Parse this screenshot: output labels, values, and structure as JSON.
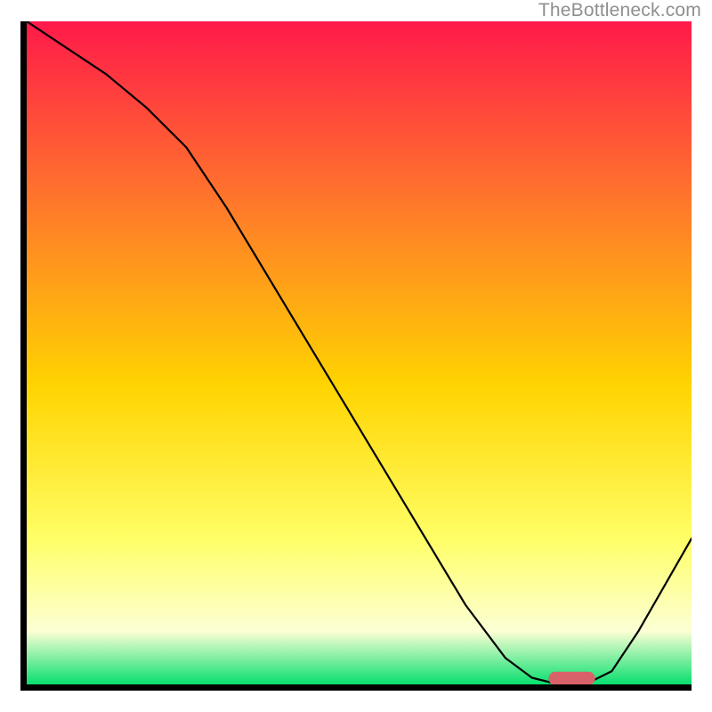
{
  "watermark": "TheBottleneck.com",
  "chart_data": {
    "type": "line",
    "title": "",
    "xlabel": "",
    "ylabel": "",
    "xlim": [
      0,
      100
    ],
    "ylim": [
      0,
      100
    ],
    "grid": false,
    "gradient_colors": {
      "top": "#ff1a4a",
      "upper_mid": "#ff7a2a",
      "mid": "#ffd400",
      "lower_mid": "#ffff66",
      "band_light": "#fcffd4",
      "bottom": "#08df6f"
    },
    "series": [
      {
        "name": "bottleneck-curve",
        "x": [
          0,
          6,
          12,
          18,
          24,
          30,
          36,
          42,
          48,
          54,
          60,
          66,
          72,
          76,
          80,
          84,
          88,
          92,
          96,
          100
        ],
        "y": [
          100,
          96,
          92,
          87,
          81,
          72,
          62,
          52,
          42,
          32,
          22,
          12,
          4,
          1,
          0,
          0,
          2,
          8,
          15,
          22
        ]
      }
    ],
    "marker": {
      "name": "optimal-range",
      "x_center": 82,
      "y": 0.9,
      "width": 7,
      "height": 2.0
    }
  }
}
